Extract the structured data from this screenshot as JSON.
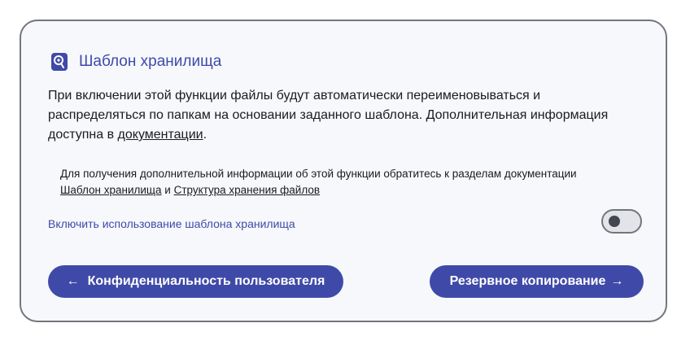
{
  "section": {
    "icon": "storage-template-icon",
    "title": "Шаблон хранилища",
    "description": {
      "text_before_link": "При включении этой функции файлы будут автоматически переименовываться и распределяться по папкам на основании заданного шаблона. Дополнительная информация доступна в ",
      "link_text": "документации",
      "text_after_link": "."
    },
    "note": {
      "text_before": "Для получения дополнительной информации об этой функции обратитесь к разделам документации ",
      "link1": "Шаблон хранилища",
      "connector": " и ",
      "link2": "Структура хранения файлов"
    },
    "toggle": {
      "label": "Включить использование шаблона хранилища",
      "enabled": false
    }
  },
  "navigation": {
    "prev": {
      "arrow": "←",
      "label": "Конфиденциальность пользователя"
    },
    "next": {
      "arrow": "→",
      "label": "Резервное копирование"
    }
  },
  "colors": {
    "accent": "#3f4aa8",
    "card_background": "#f6f8fc",
    "border": "#74757c"
  }
}
